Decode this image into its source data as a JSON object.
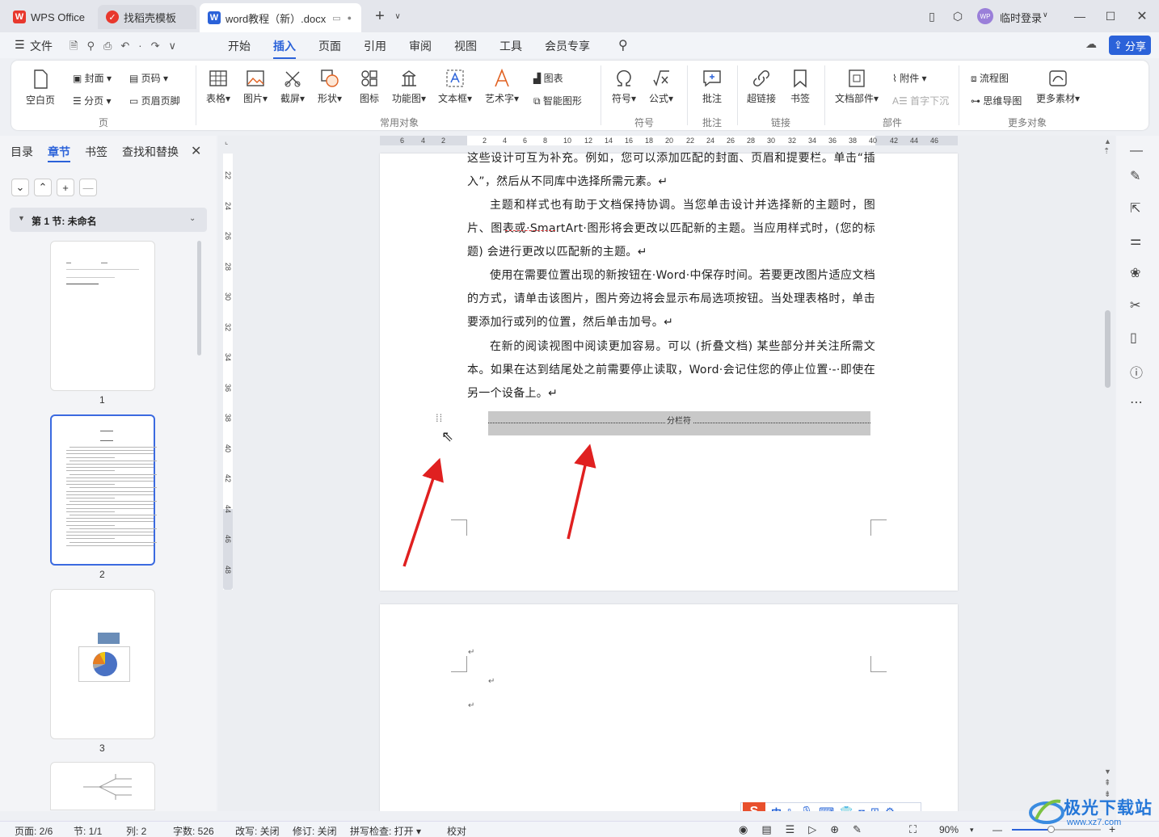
{
  "tabs": {
    "wps": "WPS Office",
    "template": "找稻壳模板",
    "doc": "word教程（新）.docx"
  },
  "titlebar": {
    "user": "临时登录",
    "avatar": "WP"
  },
  "menu": {
    "file": "文件",
    "items": [
      "开始",
      "插入",
      "页面",
      "引用",
      "审阅",
      "视图",
      "工具",
      "会员专享"
    ],
    "share": "分享"
  },
  "ribbon": {
    "page": {
      "blank": "空白页",
      "cover": "封面",
      "section": "分页",
      "pagenum": "页码",
      "header": "页眉页脚",
      "group": "页"
    },
    "objects": {
      "table": "表格",
      "picture": "图片",
      "screenshot": "截屏",
      "shape": "形状",
      "icon": "图标",
      "funcchart": "功能图",
      "textbox": "文本框",
      "wordart": "艺术字",
      "chart": "图表",
      "smart": "智能图形",
      "group": "常用对象"
    },
    "symbols": {
      "symbol": "符号",
      "formula": "公式",
      "group": "符号"
    },
    "comment": {
      "comment": "批注",
      "group": "批注"
    },
    "link": {
      "hyperlink": "超链接",
      "bookmark": "书签",
      "group": "链接"
    },
    "parts": {
      "docparts": "文档部件",
      "attach": "附件",
      "dropcap": "首字下沉",
      "group": "部件"
    },
    "more": {
      "flow": "流程图",
      "mind": "思维导图",
      "material": "更多素材",
      "group": "更多对象"
    }
  },
  "leftpanel": {
    "tabs": [
      "目录",
      "章节",
      "书签",
      "查找和替换"
    ],
    "section": "第 1 节: 未命名",
    "pages": [
      "1",
      "2",
      "3"
    ]
  },
  "ruler": {
    "h": [
      "6",
      "4",
      "2",
      "2",
      "4",
      "6",
      "8",
      "10",
      "12",
      "14",
      "16",
      "18",
      "20",
      "22",
      "24",
      "26",
      "28",
      "30",
      "32",
      "34",
      "36",
      "38",
      "40",
      "42",
      "44",
      "46"
    ],
    "v": [
      "22",
      "24",
      "26",
      "28",
      "30",
      "32",
      "34",
      "36",
      "38",
      "40",
      "42",
      "44",
      "46",
      "48"
    ]
  },
  "document": {
    "paragraphs": [
      "这些设计可互为补充。例如，您可以添加匹配的封面、页眉和提要栏。单击“插入”，然后从不同库中选择所需元素。↵",
      "主题和样式也有助于文档保持协调。当您单击设计并选择新的主题时，图片、图表或·SmartArt·图形将会更改以匹配新的主题。当应用样式时，(您的标题) 会进行更改以匹配新的主题。↵",
      "使用在需要位置出现的新按钮在·Word·中保存时间。若要更改图片适应文档的方式，请单击该图片，图片旁边将会显示布局选项按钮。当处理表格时，单击要添加行或列的位置，然后单击加号。↵",
      "在新的阅读视图中阅读更加容易。可以 (折叠文档) 某些部分并关注所需文本。如果在达到结尾处之前需要停止读取，Word·会记住您的停止位置·-·即使在另一个设备上。↵"
    ],
    "column_break": "分栏符",
    "mark": "↵"
  },
  "ime": {
    "lang": "中"
  },
  "statusbar": {
    "page": "页面: 2/6",
    "section": "节: 1/1",
    "col": "列: 2",
    "words": "字数: 526",
    "rewrite": "改写: 关闭",
    "track": "修订: 关闭",
    "spell": "拼写检查: 打开",
    "proof": "校对",
    "zoom": "90%"
  },
  "watermark": {
    "text": "极光下载站",
    "url": "www.xz7.com"
  },
  "colors": {
    "accent": "#2b62d9",
    "arrow": "#e02020",
    "wps": "#e8382d"
  }
}
